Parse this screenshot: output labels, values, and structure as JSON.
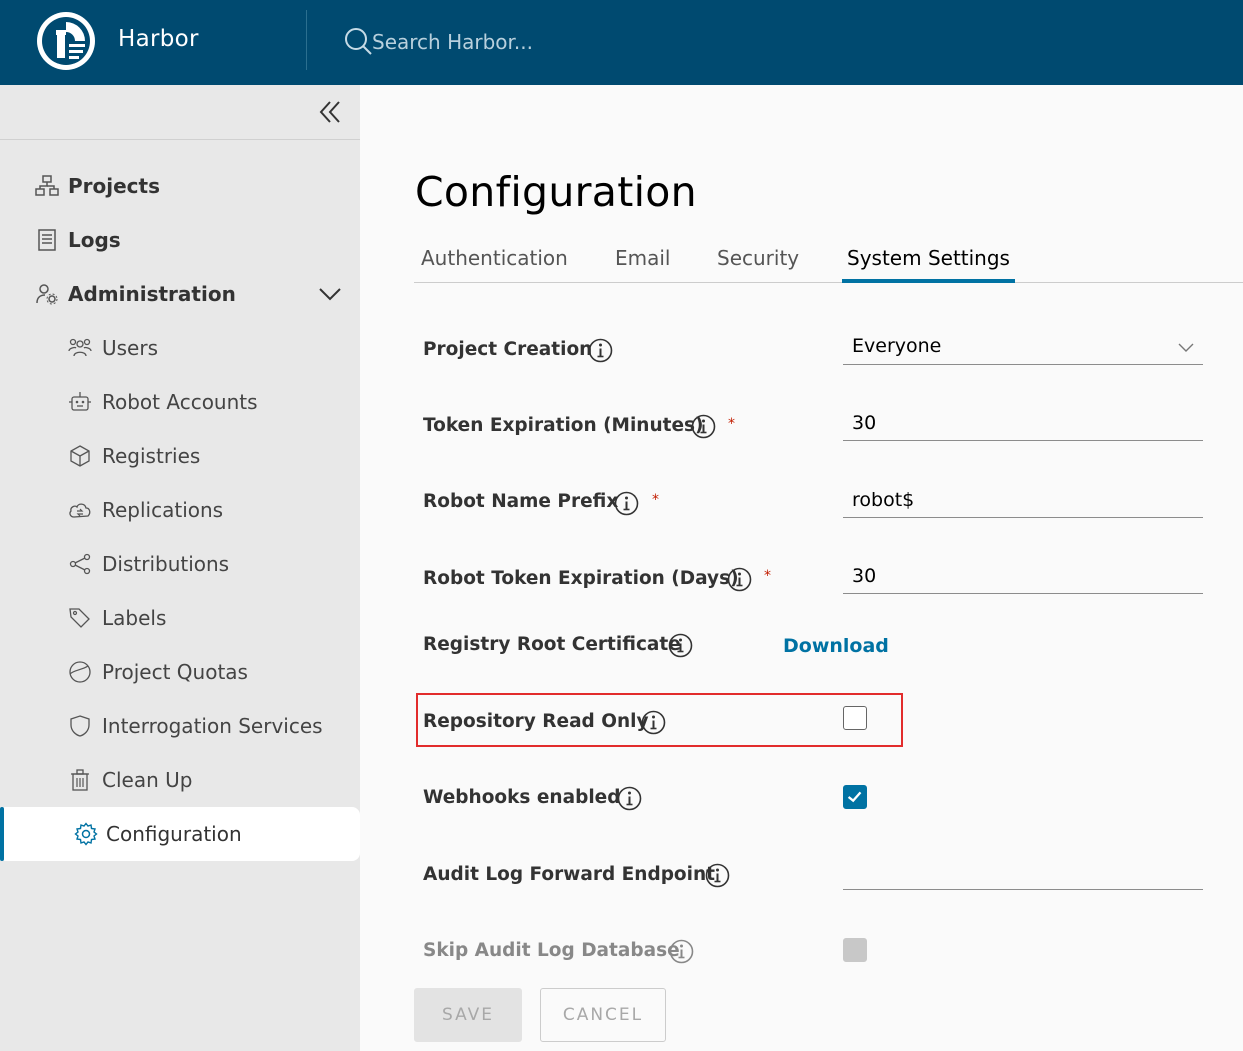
{
  "header": {
    "app_name": "Harbor",
    "search_placeholder": "Search Harbor..."
  },
  "sidebar": {
    "items": [
      {
        "label": "Projects",
        "icon": "projects-icon"
      },
      {
        "label": "Logs",
        "icon": "logs-icon"
      },
      {
        "label": "Administration",
        "icon": "administration-icon",
        "expanded": true
      },
      {
        "label": "Users",
        "icon": "users-icon"
      },
      {
        "label": "Robot Accounts",
        "icon": "robot-icon"
      },
      {
        "label": "Registries",
        "icon": "registries-icon"
      },
      {
        "label": "Replications",
        "icon": "replications-icon"
      },
      {
        "label": "Distributions",
        "icon": "distributions-icon"
      },
      {
        "label": "Labels",
        "icon": "labels-icon"
      },
      {
        "label": "Project Quotas",
        "icon": "quotas-icon"
      },
      {
        "label": "Interrogation Services",
        "icon": "shield-icon"
      },
      {
        "label": "Clean Up",
        "icon": "trash-icon"
      },
      {
        "label": "Configuration",
        "icon": "gear-icon",
        "active": true
      }
    ]
  },
  "main": {
    "title": "Configuration",
    "tabs": [
      {
        "label": "Authentication"
      },
      {
        "label": "Email"
      },
      {
        "label": "Security"
      },
      {
        "label": "System Settings",
        "active": true
      }
    ],
    "fields": {
      "project_creation": {
        "label": "Project Creation",
        "value": "Everyone"
      },
      "token_expiration": {
        "label": "Token Expiration (Minutes)",
        "value": "30",
        "required": "*"
      },
      "robot_name_prefix": {
        "label": "Robot Name Prefix",
        "value": "robot$",
        "required": "*"
      },
      "robot_token_expiration": {
        "label": "Robot Token Expiration (Days)",
        "value": "30",
        "required": "*"
      },
      "registry_root_cert": {
        "label": "Registry Root Certificate",
        "link": "Download"
      },
      "repository_read_only": {
        "label": "Repository Read Only",
        "checked": false
      },
      "webhooks_enabled": {
        "label": "Webhooks enabled",
        "checked": true
      },
      "audit_log_endpoint": {
        "label": "Audit Log Forward Endpoint",
        "value": ""
      },
      "skip_audit_log_db": {
        "label": "Skip Audit Log Database",
        "checked": false,
        "disabled": true
      }
    },
    "buttons": {
      "save": "SAVE",
      "cancel": "CANCEL"
    }
  },
  "colors": {
    "header_bg": "#004a70",
    "accent": "#0072a3",
    "highlight": "#e22c2c",
    "required": "#c21d00"
  }
}
